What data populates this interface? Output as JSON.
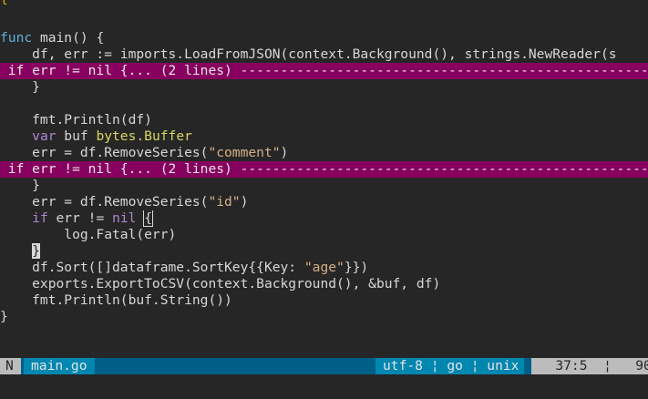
{
  "code": {
    "l1": {
      "kw": "func",
      "rest": " main() {"
    },
    "l2": "    df, err := imports.LoadFromJSON(context.Background(), strings.NewReader(s",
    "fold1": " if err != nil {... (2 lines) ---------------------------------------------------",
    "l3": "    }",
    "l5": "    fmt.Println(df)",
    "l6": {
      "kw": "var",
      "name": " buf ",
      "type": "bytes.Buffer"
    },
    "l7": {
      "pre": "    err = df.RemoveSeries(",
      "str": "\"comment\"",
      "post": ")"
    },
    "fold2": " if err != nil {... (2 lines) ---------------------------------------------------",
    "l8": "    }",
    "l9": {
      "pre": "    err = df.RemoveSeries(",
      "str": "\"id\"",
      "post": ")"
    },
    "l10": {
      "kw": "if",
      "mid": " err != ",
      "nil": "nil",
      "brace": "{"
    },
    "l11": "        log.Fatal(err)",
    "l12": "}",
    "l13": {
      "pre": "    df.Sort([]dataframe.SortKey{{Key: ",
      "str": "\"age\"",
      "post": "}})"
    },
    "l14": "    exports.ExportToCSV(context.Background(), &buf, df)",
    "l15": "    fmt.Println(buf.String())",
    "l16": "}"
  },
  "statusbar": {
    "mode": "N",
    "filename": "main.go",
    "encoding": "utf-8",
    "filetype": "go",
    "fileformat": "unix",
    "separator": "¦",
    "position": "37:5",
    "percent": "90%"
  },
  "colors": {
    "background": "#262626",
    "fold_highlight": "#87005f",
    "statusbar_accent": "#0087af"
  }
}
